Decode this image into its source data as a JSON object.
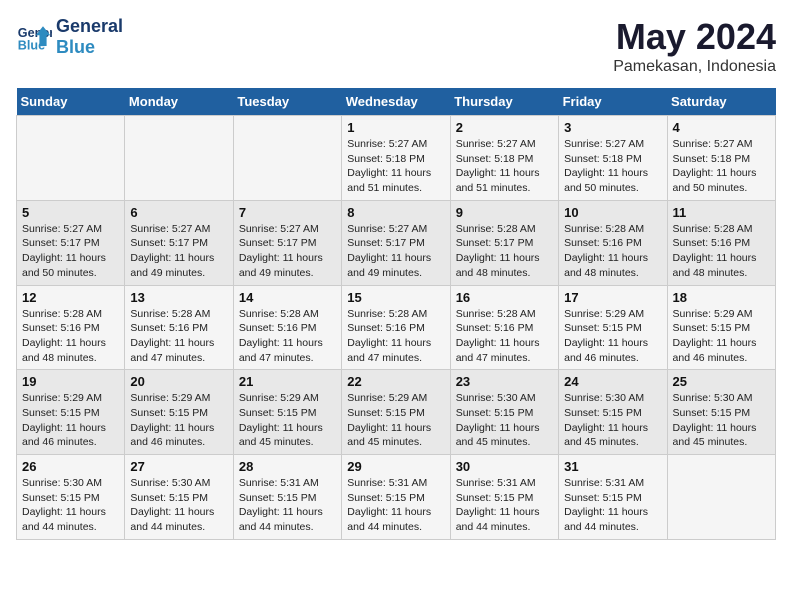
{
  "logo": {
    "line1": "General",
    "line2": "Blue"
  },
  "title": "May 2024",
  "subtitle": "Pamekasan, Indonesia",
  "days_of_week": [
    "Sunday",
    "Monday",
    "Tuesday",
    "Wednesday",
    "Thursday",
    "Friday",
    "Saturday"
  ],
  "weeks": [
    [
      {
        "num": "",
        "info": ""
      },
      {
        "num": "",
        "info": ""
      },
      {
        "num": "",
        "info": ""
      },
      {
        "num": "1",
        "info": "Sunrise: 5:27 AM\nSunset: 5:18 PM\nDaylight: 11 hours\nand 51 minutes."
      },
      {
        "num": "2",
        "info": "Sunrise: 5:27 AM\nSunset: 5:18 PM\nDaylight: 11 hours\nand 51 minutes."
      },
      {
        "num": "3",
        "info": "Sunrise: 5:27 AM\nSunset: 5:18 PM\nDaylight: 11 hours\nand 50 minutes."
      },
      {
        "num": "4",
        "info": "Sunrise: 5:27 AM\nSunset: 5:18 PM\nDaylight: 11 hours\nand 50 minutes."
      }
    ],
    [
      {
        "num": "5",
        "info": "Sunrise: 5:27 AM\nSunset: 5:17 PM\nDaylight: 11 hours\nand 50 minutes."
      },
      {
        "num": "6",
        "info": "Sunrise: 5:27 AM\nSunset: 5:17 PM\nDaylight: 11 hours\nand 49 minutes."
      },
      {
        "num": "7",
        "info": "Sunrise: 5:27 AM\nSunset: 5:17 PM\nDaylight: 11 hours\nand 49 minutes."
      },
      {
        "num": "8",
        "info": "Sunrise: 5:27 AM\nSunset: 5:17 PM\nDaylight: 11 hours\nand 49 minutes."
      },
      {
        "num": "9",
        "info": "Sunrise: 5:28 AM\nSunset: 5:17 PM\nDaylight: 11 hours\nand 48 minutes."
      },
      {
        "num": "10",
        "info": "Sunrise: 5:28 AM\nSunset: 5:16 PM\nDaylight: 11 hours\nand 48 minutes."
      },
      {
        "num": "11",
        "info": "Sunrise: 5:28 AM\nSunset: 5:16 PM\nDaylight: 11 hours\nand 48 minutes."
      }
    ],
    [
      {
        "num": "12",
        "info": "Sunrise: 5:28 AM\nSunset: 5:16 PM\nDaylight: 11 hours\nand 48 minutes."
      },
      {
        "num": "13",
        "info": "Sunrise: 5:28 AM\nSunset: 5:16 PM\nDaylight: 11 hours\nand 47 minutes."
      },
      {
        "num": "14",
        "info": "Sunrise: 5:28 AM\nSunset: 5:16 PM\nDaylight: 11 hours\nand 47 minutes."
      },
      {
        "num": "15",
        "info": "Sunrise: 5:28 AM\nSunset: 5:16 PM\nDaylight: 11 hours\nand 47 minutes."
      },
      {
        "num": "16",
        "info": "Sunrise: 5:28 AM\nSunset: 5:16 PM\nDaylight: 11 hours\nand 47 minutes."
      },
      {
        "num": "17",
        "info": "Sunrise: 5:29 AM\nSunset: 5:15 PM\nDaylight: 11 hours\nand 46 minutes."
      },
      {
        "num": "18",
        "info": "Sunrise: 5:29 AM\nSunset: 5:15 PM\nDaylight: 11 hours\nand 46 minutes."
      }
    ],
    [
      {
        "num": "19",
        "info": "Sunrise: 5:29 AM\nSunset: 5:15 PM\nDaylight: 11 hours\nand 46 minutes."
      },
      {
        "num": "20",
        "info": "Sunrise: 5:29 AM\nSunset: 5:15 PM\nDaylight: 11 hours\nand 46 minutes."
      },
      {
        "num": "21",
        "info": "Sunrise: 5:29 AM\nSunset: 5:15 PM\nDaylight: 11 hours\nand 45 minutes."
      },
      {
        "num": "22",
        "info": "Sunrise: 5:29 AM\nSunset: 5:15 PM\nDaylight: 11 hours\nand 45 minutes."
      },
      {
        "num": "23",
        "info": "Sunrise: 5:30 AM\nSunset: 5:15 PM\nDaylight: 11 hours\nand 45 minutes."
      },
      {
        "num": "24",
        "info": "Sunrise: 5:30 AM\nSunset: 5:15 PM\nDaylight: 11 hours\nand 45 minutes."
      },
      {
        "num": "25",
        "info": "Sunrise: 5:30 AM\nSunset: 5:15 PM\nDaylight: 11 hours\nand 45 minutes."
      }
    ],
    [
      {
        "num": "26",
        "info": "Sunrise: 5:30 AM\nSunset: 5:15 PM\nDaylight: 11 hours\nand 44 minutes."
      },
      {
        "num": "27",
        "info": "Sunrise: 5:30 AM\nSunset: 5:15 PM\nDaylight: 11 hours\nand 44 minutes."
      },
      {
        "num": "28",
        "info": "Sunrise: 5:31 AM\nSunset: 5:15 PM\nDaylight: 11 hours\nand 44 minutes."
      },
      {
        "num": "29",
        "info": "Sunrise: 5:31 AM\nSunset: 5:15 PM\nDaylight: 11 hours\nand 44 minutes."
      },
      {
        "num": "30",
        "info": "Sunrise: 5:31 AM\nSunset: 5:15 PM\nDaylight: 11 hours\nand 44 minutes."
      },
      {
        "num": "31",
        "info": "Sunrise: 5:31 AM\nSunset: 5:15 PM\nDaylight: 11 hours\nand 44 minutes."
      },
      {
        "num": "",
        "info": ""
      }
    ]
  ]
}
